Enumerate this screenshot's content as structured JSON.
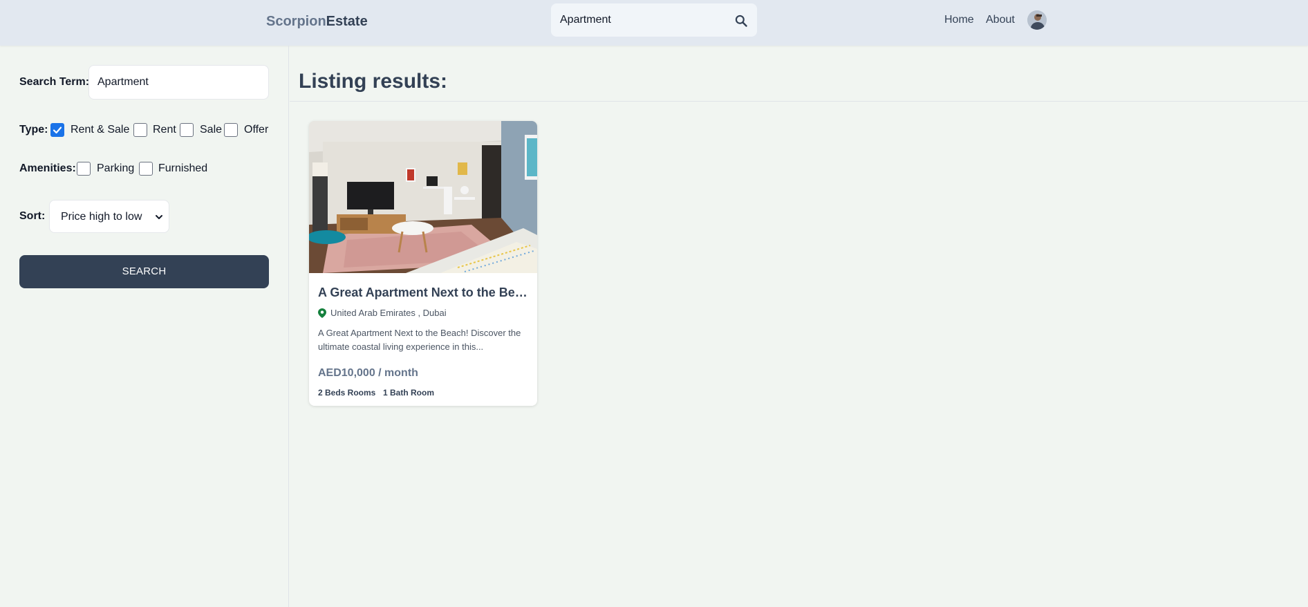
{
  "header": {
    "logo_part1": "Scorpion",
    "logo_part2": "Estate",
    "search_value": "Apartment",
    "nav": {
      "home": "Home",
      "about": "About"
    }
  },
  "sidebar": {
    "search_term_label": "Search Term:",
    "search_term_value": "Apartment",
    "type_label": "Type:",
    "type_options": [
      {
        "label": "Rent & Sale",
        "checked": true
      },
      {
        "label": "Rent",
        "checked": false
      },
      {
        "label": "Sale",
        "checked": false
      },
      {
        "label": "Offer",
        "checked": false
      }
    ],
    "amenities_label": "Amenities:",
    "amenities_options": [
      {
        "label": "Parking",
        "checked": false
      },
      {
        "label": "Furnished",
        "checked": false
      }
    ],
    "sort_label": "Sort:",
    "sort_value": "Price high to low",
    "search_button": "SEARCH"
  },
  "main": {
    "title": "Listing results:",
    "listings": [
      {
        "title": "A Great Apartment Next to the Beach!",
        "location": "United Arab Emirates , Dubai",
        "description": "A Great Apartment Next to the Beach! Discover the ultimate coastal living experience in this...",
        "price": "AED10,000 / month",
        "beds": "2 Beds Rooms",
        "baths": "1 Bath Room"
      }
    ]
  },
  "colors": {
    "header_bg": "#e2e8f0",
    "page_bg": "#f1f5f1",
    "button_bg": "#334155",
    "checkbox_accent": "#1a73e8",
    "location_pin": "#15803d"
  }
}
